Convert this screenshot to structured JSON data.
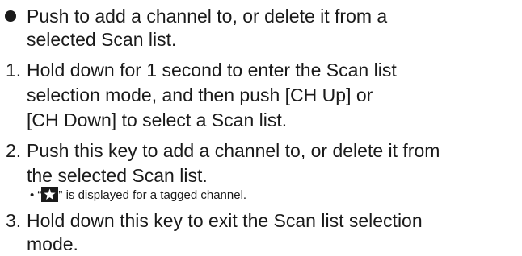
{
  "bullet_item": {
    "line1": "Push to add a channel to, or delete it from a",
    "line2": "selected Scan list."
  },
  "steps": [
    {
      "number": "1.",
      "lines": [
        "Hold down for 1 second to enter the Scan list",
        "selection mode, and then push [CH Up] or",
        "[CH Down] to select a Scan list."
      ]
    },
    {
      "number": "2.",
      "lines": [
        "Push this key to add a channel to, or delete it from",
        "the selected Scan list."
      ],
      "note": {
        "prefix": "• “",
        "icon": "star-icon",
        "suffix": "” is displayed for a tagged channel."
      }
    },
    {
      "number": "3.",
      "lines": [
        "Hold down this key to exit the Scan list selection",
        "mode."
      ]
    }
  ]
}
